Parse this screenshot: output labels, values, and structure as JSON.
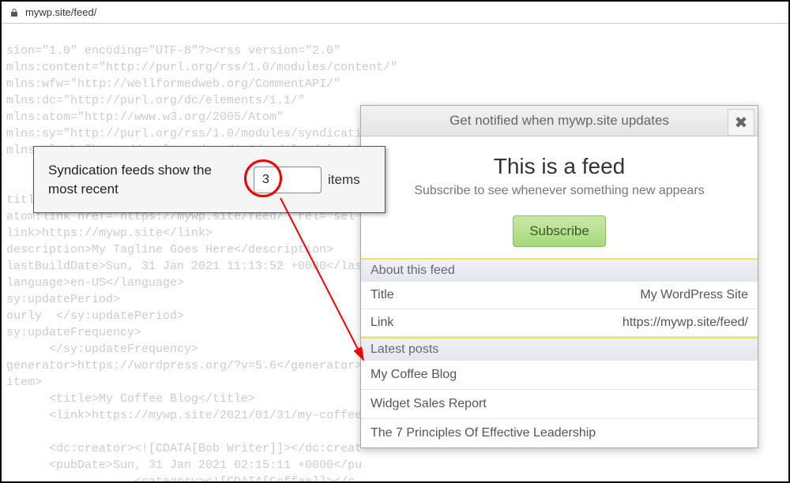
{
  "browser": {
    "url": "mywp.site/feed/"
  },
  "xml_background": "sion=\"1.0\" encoding=\"UTF-8\"?><rss version=\"2.0\"\nmlns:content=\"http://purl.org/rss/1.0/modules/content/\"\nmlns:wfw=\"http://wellformedweb.org/CommentAPI/\"\nmlns:dc=\"http://purl.org/dc/elements/1.1/\"\nmlns:atom=\"http://www.w3.org/2005/Atom\"\nmlns:sy=\"http://purl.org/rss/1.0/modules/syndicati\nmlns:slash=\"http://purl.org/rss/1.0/modules/slash/\n\n\ntitle\natom:link href=\"https://mywp.site/feed/\" rel=\"sel\nlink>https://mywp.site</link>\ndescription>My Tagline Goes Here</description>\nlastBuildDate>Sun, 31 Jan 2021 11:13:52 +0000</las\nlanguage>en-US</language>\nsy:updatePeriod>\nourly  </sy:updatePeriod>\nsy:updateFrequency>\n      </sy:updateFrequency>\ngenerator>https://wordpress.org/?v=5.6</generator>\nitem>\n      <title>My Coffee Blog</title>\n      <link>https://mywp.site/2021/01/31/my-coffee-\n\n      <dc:creator><![CDATA[Bob Writer]]></dc:creat\n      <pubDate>Sun, 31 Jan 2021 02:15:11 +0000</pu\n                  <category><![CDATA[Coffee]]></c\n      <category><![CDATA[Caffeine]]></category>",
  "setting": {
    "label": "Syndication feeds show the most recent",
    "value": "3",
    "suffix": "items"
  },
  "popup": {
    "header": "Get notified when mywp.site updates",
    "title": "This is a feed",
    "subtitle": "Subscribe to see whenever something new appears",
    "subscribe_label": "Subscribe",
    "about_header": "About this feed",
    "about": {
      "title_label": "Title",
      "title_value": "My WordPress Site",
      "link_label": "Link",
      "link_value": "https://mywp.site/feed/"
    },
    "latest_header": "Latest posts",
    "posts": [
      "My Coffee Blog",
      "Widget Sales Report",
      "The 7 Principles Of Effective Leadership"
    ]
  }
}
